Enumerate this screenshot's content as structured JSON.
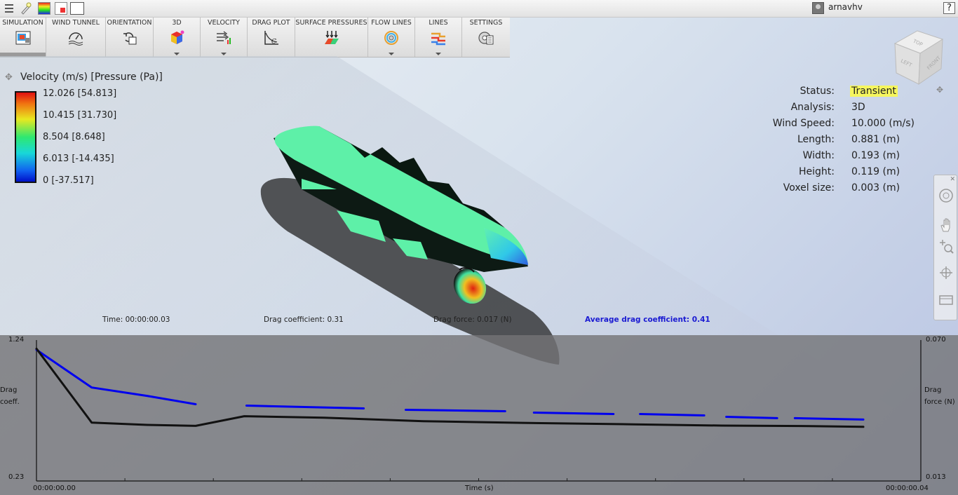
{
  "topbar": {
    "user": "arnavhv",
    "help": "?"
  },
  "ribbon": {
    "tabs": [
      {
        "label": "SIMULATION",
        "icon": "simulation-icon",
        "dropdown": false
      },
      {
        "label": "WIND TUNNEL",
        "icon": "wind-tunnel-icon",
        "dropdown": false
      },
      {
        "label": "ORIENTATION",
        "icon": "orientation-icon",
        "dropdown": false
      },
      {
        "label": "3D",
        "icon": "cube-3d-icon",
        "dropdown": true
      },
      {
        "label": "VELOCITY",
        "icon": "velocity-icon",
        "dropdown": true
      },
      {
        "label": "DRAG PLOT",
        "icon": "drag-plot-icon",
        "dropdown": false
      },
      {
        "label": "SURFACE PRESSURES",
        "icon": "surface-pressure-icon",
        "dropdown": false
      },
      {
        "label": "FLOW LINES",
        "icon": "flow-lines-icon",
        "dropdown": true
      },
      {
        "label": "LINES",
        "icon": "lines-icon",
        "dropdown": true
      },
      {
        "label": "SETTINGS",
        "icon": "settings-icon",
        "dropdown": false
      }
    ]
  },
  "legend": {
    "title": "Velocity (m/s) [Pressure (Pa)]",
    "labels": [
      "12.026 [54.813]",
      "10.415 [31.730]",
      "8.504 [8.648]",
      "6.013 [-14.435]",
      "0 [-37.517]"
    ]
  },
  "stats": [
    {
      "label": "Status:",
      "value": "Transient"
    },
    {
      "label": "Analysis:",
      "value": "3D"
    },
    {
      "label": "Wind Speed:",
      "value": "10.000 (m/s)"
    },
    {
      "label": "Length:",
      "value": "0.881 (m)"
    },
    {
      "label": "Width:",
      "value": "0.193 (m)"
    },
    {
      "label": "Height:",
      "value": "0.119 (m)"
    },
    {
      "label": "Voxel size:",
      "value": "0.003 (m)"
    }
  ],
  "viewcube": {
    "faces": [
      "TOP",
      "LEFT",
      "FRONT"
    ]
  },
  "info": {
    "time": "Time: 00:00:00.03",
    "drag_coefficient": "Drag coefficient: 0.31",
    "drag_force": "Drag force: 0.017 (N)",
    "avg_drag": "Average drag coefficient: 0.41"
  },
  "chart": {
    "y_left_max": "1.24",
    "y_left_min": "0.23",
    "y_left_label": [
      "Drag",
      "coeff."
    ],
    "y_right_max": "0.070",
    "y_right_min": "0.013",
    "y_right_label": [
      "Drag",
      "force (N)"
    ],
    "x_start": "00:00:00.00",
    "x_end": "00:00:00.04",
    "x_label": "Time (s)"
  },
  "chart_data": {
    "type": "line",
    "title": "",
    "xlabel": "Time (s)",
    "ylabel": "Drag coeff.",
    "ylabel_right": "Drag force (N)",
    "xlim": [
      0,
      0.04
    ],
    "ylim": [
      0.23,
      1.24
    ],
    "ylim_right": [
      0.013,
      0.07
    ],
    "series": [
      {
        "name": "Drag coeff.",
        "color": "#0000ee",
        "axis": "left",
        "x": [
          0.0,
          0.0025,
          0.005,
          0.0072,
          0.0095,
          0.0148,
          0.0167,
          0.0212,
          0.0225,
          0.0261,
          0.0273,
          0.0302,
          0.0312,
          0.0335,
          0.0343,
          0.0374
        ],
        "y": [
          1.17,
          0.9,
          0.84,
          0.78,
          0.77,
          0.75,
          0.74,
          0.73,
          0.72,
          0.71,
          0.71,
          0.7,
          0.69,
          0.68,
          0.68,
          0.67
        ],
        "segments": [
          [
            0,
            3
          ],
          [
            4,
            5
          ],
          [
            6,
            7
          ],
          [
            8,
            9
          ],
          [
            10,
            11
          ],
          [
            12,
            13
          ],
          [
            14,
            15
          ]
        ]
      },
      {
        "name": "Drag force (N)",
        "color": "#111111",
        "axis": "right",
        "x": [
          0.0,
          0.0025,
          0.005,
          0.0072,
          0.0094,
          0.013,
          0.0175,
          0.022,
          0.027,
          0.031,
          0.035,
          0.0374
        ],
        "y": [
          0.0665,
          0.0366,
          0.0357,
          0.0353,
          0.0392,
          0.0386,
          0.0372,
          0.0365,
          0.0359,
          0.0354,
          0.0352,
          0.0349
        ]
      }
    ],
    "grid": true,
    "legend": "none"
  },
  "colors": {
    "status_highlight": "#f6f65e",
    "avg_text": "#1a1ad2",
    "series_blue": "#0000ee",
    "series_black": "#111111"
  }
}
